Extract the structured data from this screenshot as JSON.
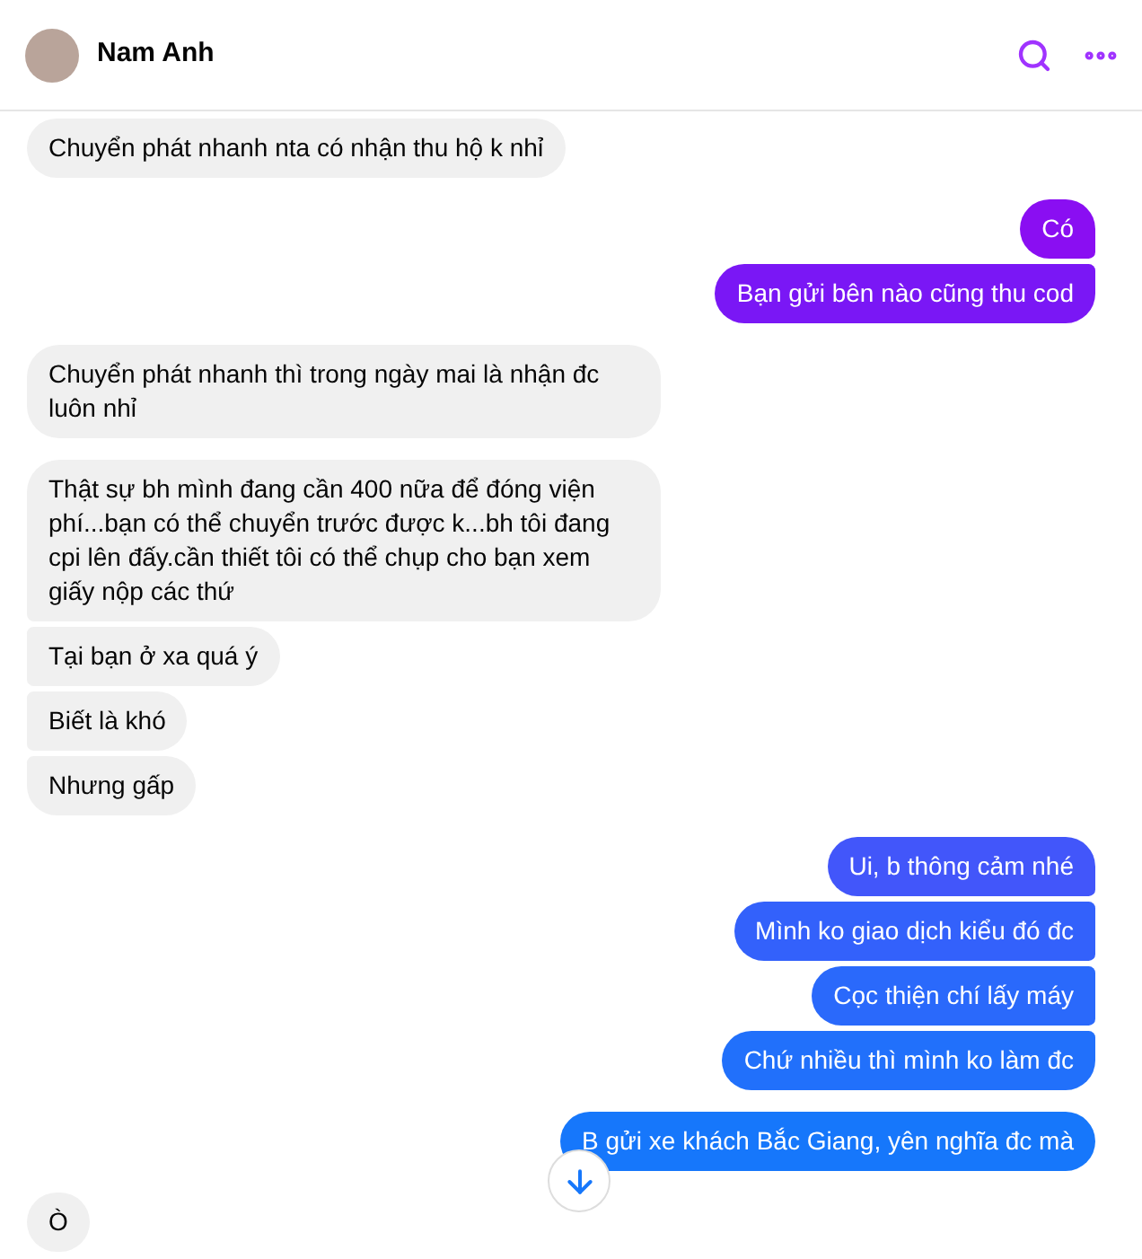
{
  "header": {
    "name": "Nam Anh"
  },
  "groups": [
    {
      "kind": "incoming",
      "messages": [
        {
          "text": "Chuyển phát nhanh nta có nhận thu hộ k nhỉ"
        }
      ]
    },
    {
      "kind": "outgoing",
      "messages": [
        {
          "text": "Có",
          "color": "#8a0ef2"
        },
        {
          "text": "Bạn gửi bên nào cũng thu cod",
          "color": "#7a17f5"
        }
      ]
    },
    {
      "kind": "incoming",
      "messages": [
        {
          "text": "Chuyển phát nhanh thì trong ngày mai là nhận đc luôn nhỉ"
        }
      ]
    },
    {
      "kind": "incoming",
      "messages": [
        {
          "text": "Thật sự bh mình đang cần 400 nữa để đóng viện phí...bạn có thể chuyển trước được k...bh tôi đang cpi lên đấy.cần thiết tôi có thể chụp cho bạn xem giấy nộp các thứ"
        },
        {
          "text": "Tại bạn ở xa quá ý"
        },
        {
          "text": "Biết là khó"
        },
        {
          "text": "Nhưng gấp"
        }
      ]
    },
    {
      "kind": "outgoing",
      "messages": [
        {
          "text": "Ui, b thông cảm nhé",
          "color": "#4256fa"
        },
        {
          "text": "Mình ko giao dịch kiểu đó đc",
          "color": "#3361fb"
        },
        {
          "text": "Cọc thiện chí lấy máy",
          "color": "#2a69fb"
        },
        {
          "text": "Chứ nhiều thì mình ko làm đc",
          "color": "#2170fb"
        }
      ]
    },
    {
      "kind": "outgoing",
      "messages": [
        {
          "text": "B gửi xe khách Bắc Giang, yên nghĩa đc mà",
          "color": "#1677fb"
        }
      ]
    },
    {
      "kind": "incoming",
      "messages": [
        {
          "text": "Ò"
        }
      ]
    }
  ]
}
